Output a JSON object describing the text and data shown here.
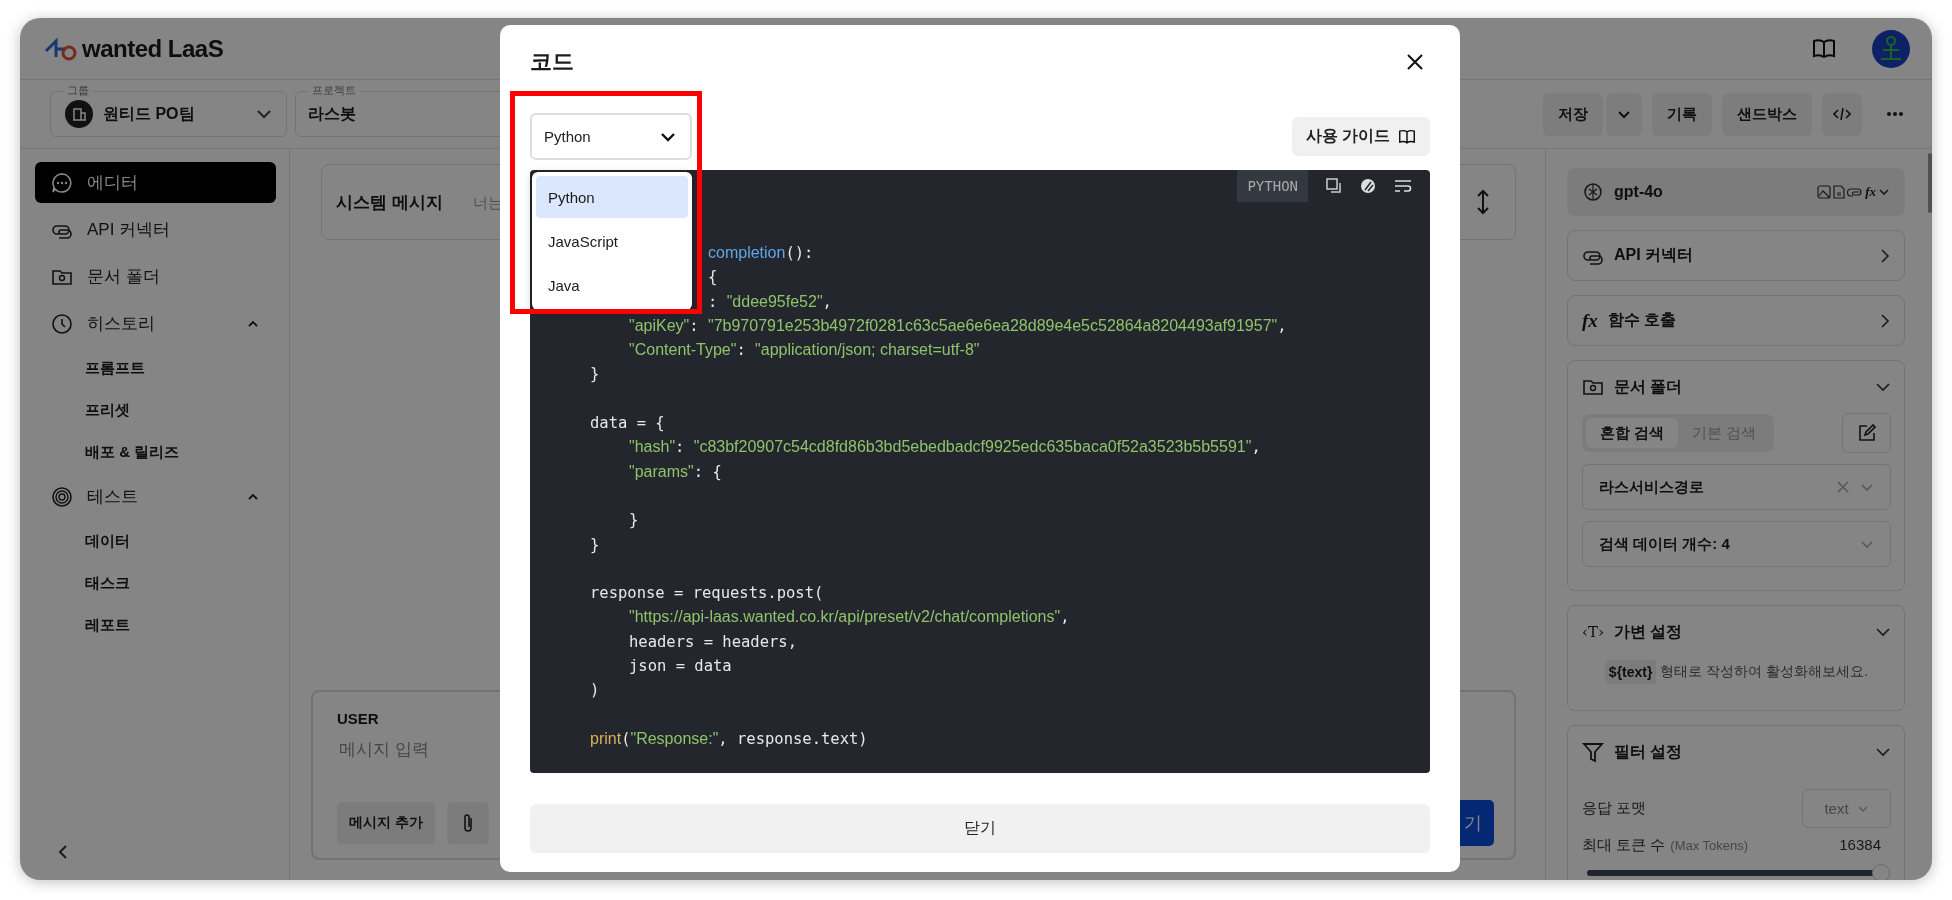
{
  "app": {
    "logo": "wanted LaaS"
  },
  "toolbar": {
    "group": {
      "legend": "그룹",
      "value": "원티드 PO팀"
    },
    "project": {
      "legend": "프로젝트",
      "value": "라스봇"
    },
    "save": "저장",
    "history": "기록",
    "sandbox": "샌드박스"
  },
  "sidebar": {
    "items": [
      {
        "kind": "chat",
        "label": "에디터",
        "selected": true
      },
      {
        "kind": "link",
        "label": "API 커넥터",
        "selected": false
      },
      {
        "kind": "folder",
        "label": "문서 폴더",
        "selected": false
      },
      {
        "kind": "clock",
        "label": "히스토리",
        "selected": false,
        "expanded": true,
        "children": [
          {
            "label": "프롬프트",
            "selected": false
          },
          {
            "label": "프리셋",
            "selected": false
          },
          {
            "label": "배포 & 릴리즈",
            "selected": false
          }
        ]
      },
      {
        "kind": "target",
        "label": "테스트",
        "selected": false,
        "expanded": true,
        "children": [
          {
            "label": "데이터",
            "selected": false
          },
          {
            "label": "태스크",
            "selected": false
          },
          {
            "label": "레포트",
            "selected": false
          }
        ]
      }
    ]
  },
  "main": {
    "system": {
      "title": "시스템 메시지",
      "placeholder": "너는"
    },
    "user": {
      "role": "USER",
      "placeholder": "메시지 입력",
      "add_button": "메시지 추가",
      "submit_button": "기"
    }
  },
  "settings": {
    "model": {
      "name": "gpt-4o",
      "fx": "fx"
    },
    "api_connector": "API 커넥터",
    "function_call": {
      "icon": "fx",
      "label": "함수 호출"
    },
    "documents": {
      "title": "문서 폴더",
      "expanded": true,
      "modes": [
        {
          "label": "혼합 검색",
          "selected": true
        },
        {
          "label": "기본 검색",
          "selected": false
        }
      ],
      "folder": "라스서비스경로",
      "count": "검색 데이터 개수: 4"
    },
    "variables": {
      "icon": "‹T›",
      "title": "가변 설정",
      "expanded": true,
      "chip": "${text}",
      "hint": "형태로 작성하여 활성화해보세요."
    },
    "filter": {
      "title": "필터 설정",
      "expanded": true,
      "format_label": "응답 포맷",
      "format_value": "text",
      "tokens_label": "최대 토큰 수",
      "tokens_hint": "(Max Tokens)",
      "tokens_value": "16384",
      "level": 1
    }
  },
  "modal": {
    "title": "코드",
    "language_select": {
      "value": "Python",
      "open": true,
      "options": [
        {
          "label": "Python",
          "selected": true
        },
        {
          "label": "JavaScript",
          "selected": false
        },
        {
          "label": "Java",
          "selected": false
        }
      ]
    },
    "guide_button": "사용 가이드",
    "code": {
      "language": "PYTHON",
      "lines": [
        {
          "kind": "partial",
          "segments": [
            {
              "kind": "func",
              "text": "completion"
            },
            {
              "kind": "plain",
              "text": "():"
            }
          ]
        },
        {
          "kind": "partial",
          "segments": [
            {
              "kind": "plain",
              "text": "{"
            }
          ]
        },
        {
          "kind": "partial",
          "segments": [
            {
              "kind": "plain",
              "text": ": "
            },
            {
              "kind": "string",
              "text": "\"ddee95fe52\""
            },
            {
              "kind": "plain",
              "text": ","
            }
          ]
        },
        {
          "kind": "nested",
          "segments": [
            {
              "kind": "string",
              "text": "\"apiKey\""
            },
            {
              "kind": "plain",
              "text": ": "
            },
            {
              "kind": "string",
              "text": "\"7b970791e253b4972f0281c63c5ae6e6ea28d89e4e5c52864a8204493af91957\""
            },
            {
              "kind": "plain",
              "text": ","
            }
          ]
        },
        {
          "kind": "nested",
          "segments": [
            {
              "kind": "string",
              "text": "\"Content-Type\""
            },
            {
              "kind": "plain",
              "text": ": "
            },
            {
              "kind": "string",
              "text": "\"application/json; charset=utf-8\""
            }
          ]
        },
        {
          "kind": "top",
          "segments": [
            {
              "kind": "plain",
              "text": "}"
            }
          ]
        },
        {
          "kind": "blank"
        },
        {
          "kind": "top",
          "segments": [
            {
              "kind": "plain",
              "text": "data = {"
            }
          ]
        },
        {
          "kind": "nested",
          "segments": [
            {
              "kind": "string",
              "text": "\"hash\""
            },
            {
              "kind": "plain",
              "text": ": "
            },
            {
              "kind": "string",
              "text": "\"c83bf20907c54cd8fd86b3bd5ebedbadcf9925edc635baca0f52a3523b5b5591\""
            },
            {
              "kind": "plain",
              "text": ","
            }
          ]
        },
        {
          "kind": "nested",
          "segments": [
            {
              "kind": "string",
              "text": "\"params\""
            },
            {
              "kind": "plain",
              "text": ": {"
            }
          ]
        },
        {
          "kind": "blank"
        },
        {
          "kind": "nested",
          "segments": [
            {
              "kind": "plain",
              "text": "}"
            }
          ]
        },
        {
          "kind": "top",
          "segments": [
            {
              "kind": "plain",
              "text": "}"
            }
          ]
        },
        {
          "kind": "blank"
        },
        {
          "kind": "top",
          "segments": [
            {
              "kind": "plain",
              "text": "response = requests.post("
            }
          ]
        },
        {
          "kind": "nested",
          "segments": [
            {
              "kind": "string",
              "text": "\"https://api-laas.wanted.co.kr/api/preset/v2/chat/completions\""
            },
            {
              "kind": "plain",
              "text": ","
            }
          ]
        },
        {
          "kind": "nested",
          "segments": [
            {
              "kind": "plain",
              "text": "headers = headers,"
            }
          ]
        },
        {
          "kind": "nested",
          "segments": [
            {
              "kind": "plain",
              "text": "json = data"
            }
          ]
        },
        {
          "kind": "top",
          "segments": [
            {
              "kind": "plain",
              "text": ")"
            }
          ]
        },
        {
          "kind": "blank"
        },
        {
          "kind": "top",
          "segments": [
            {
              "kind": "builtin",
              "text": "print"
            },
            {
              "kind": "plain",
              "text": "("
            },
            {
              "kind": "string",
              "text": "\"Response:\""
            },
            {
              "kind": "plain",
              "text": ", response.text)"
            }
          ]
        }
      ]
    },
    "close_button": "닫기"
  }
}
